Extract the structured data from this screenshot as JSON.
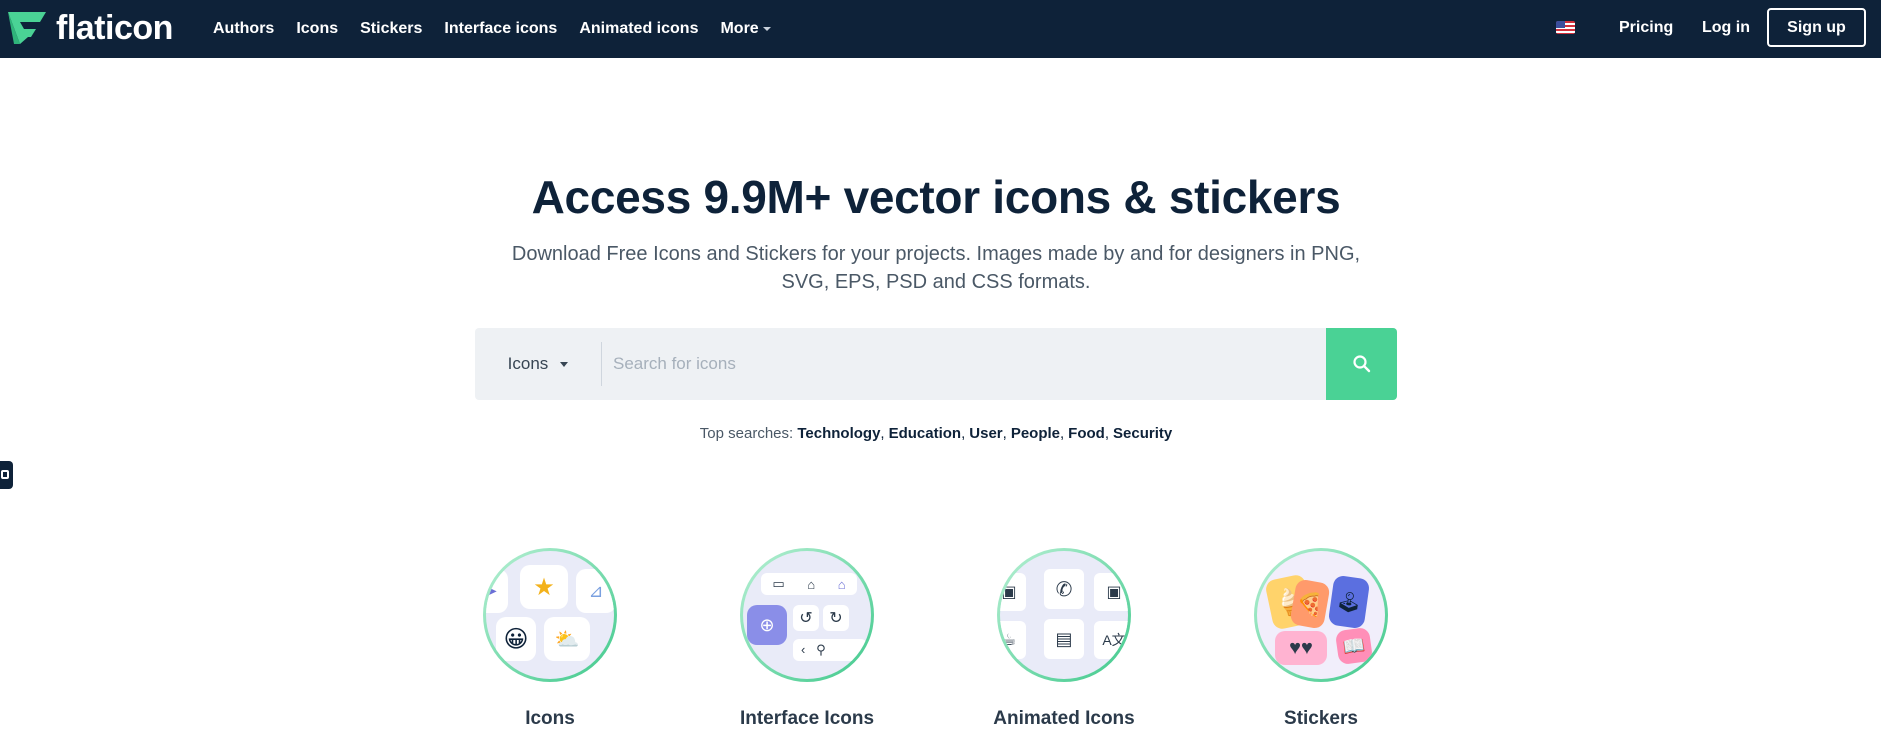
{
  "header": {
    "logo_text": "flaticon",
    "nav": [
      "Authors",
      "Icons",
      "Stickers",
      "Interface icons",
      "Animated icons"
    ],
    "more_label": "More",
    "pricing_label": "Pricing",
    "login_label": "Log in",
    "signup_label": "Sign up",
    "language": "us-flag-icon"
  },
  "hero": {
    "title": "Access 9.9M+ vector icons & stickers",
    "subtitle": "Download Free Icons and Stickers for your projects. Images made by and for designers in PNG, SVG, EPS, PSD and CSS formats."
  },
  "search": {
    "type_label": "Icons",
    "placeholder": "Search for icons",
    "value": ""
  },
  "top_searches": {
    "label": "Top searches:",
    "items": [
      "Technology",
      "Education",
      "User",
      "People",
      "Food",
      "Security"
    ]
  },
  "categories": [
    {
      "label": "Icons"
    },
    {
      "label": "Interface Icons"
    },
    {
      "label": "Animated Icons"
    },
    {
      "label": "Stickers"
    }
  ],
  "colors": {
    "header_bg": "#0e2239",
    "accent": "#4ad295",
    "search_bg": "#eef1f4"
  }
}
